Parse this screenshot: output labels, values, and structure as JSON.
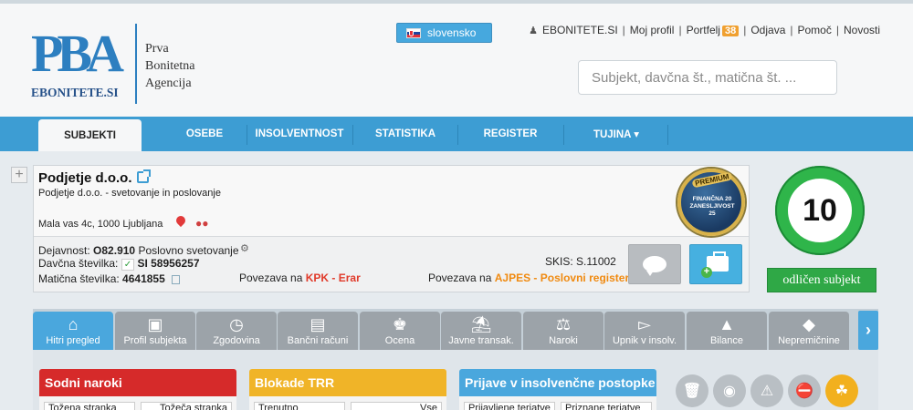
{
  "header": {
    "logo_mark": "PBA",
    "logo_domain": "EBONITETE.SI",
    "logo_line1": "Prva",
    "logo_line2": "Bonitetna",
    "logo_line3": "Agencija",
    "language": "slovensko",
    "user_link": "EBONITETE.SI",
    "profile_link": "Moj profil",
    "portfolio_link": "Portfelj",
    "portfolio_count": "38",
    "logout_link": "Odjava",
    "help_link": "Pomoč",
    "news_link": "Novosti",
    "search_placeholder": "Subjekt, davčna št., matična št. ..."
  },
  "nav": {
    "tabs": [
      "SUBJEKTI",
      "OSEBE",
      "INSOLVENTNOST",
      "STATISTIKA",
      "REGISTER",
      "TUJINA ▾"
    ]
  },
  "company": {
    "name": "Podjetje d.o.o.",
    "description": "Podjetje d.o.o. - svetovanje in poslovanje",
    "address": "Mala vas 4c, 1000 Ljubljana",
    "activity_label": "Dejavnost:",
    "activity_code": "O82.910",
    "activity_name": "Poslovno svetovanje",
    "tax_label": "Davčna številka:",
    "tax_number": "SI 58956257",
    "reg_label": "Matična številka:",
    "reg_number": "4641855",
    "kpk_prefix": "Povezava na",
    "kpk_link": "KPK - Erar",
    "ajpes_prefix": "Povezava na",
    "ajpes_link": "AJPES - Poslovni register",
    "skis_label": "SKIS:",
    "skis_value": "S.11002",
    "premium_ribbon": "PREMIUM",
    "premium_line1": "FINANČNA",
    "premium_line2": "ZANESLJIVOST",
    "premium_year1": "20",
    "premium_year2": "25"
  },
  "score": {
    "value": "10",
    "label": "odličen subjekt"
  },
  "section_tabs": [
    {
      "label": "Hitri pregled",
      "icon": "home-icon"
    },
    {
      "label": "Profil subjekta",
      "icon": "factory-icon"
    },
    {
      "label": "Zgodovina",
      "icon": "clock-icon"
    },
    {
      "label": "Bančni računi",
      "icon": "card-icon"
    },
    {
      "label": "Ocena",
      "icon": "trophy-icon"
    },
    {
      "label": "Javne transak.",
      "icon": "bank-icon"
    },
    {
      "label": "Naroki",
      "icon": "scales-icon"
    },
    {
      "label": "Upnik v insolv.",
      "icon": "megaphone-icon"
    },
    {
      "label": "Bilance",
      "icon": "chart-icon"
    },
    {
      "label": "Nepremičnine",
      "icon": "map-icon"
    }
  ],
  "panels": {
    "sodni": {
      "title": "Sodni naroki",
      "col1": "Tožena stranka",
      "col2": "Tožeča stranka",
      "color": "#d62a2a"
    },
    "blokade": {
      "title": "Blokade TRR",
      "col1": "Trenutno",
      "col2": "Vse",
      "color": "#f0b428"
    },
    "prijave": {
      "title": "Prijave v insolvenčne postopke",
      "col1": "Prijavljene terjatve",
      "col2": "Priznane terjatve",
      "color": "#4aa7dd"
    }
  },
  "status_icons": [
    "trash-icon",
    "money-bag-icon",
    "warning-icon",
    "alert-octagon-icon",
    "palm-tree-icon"
  ]
}
